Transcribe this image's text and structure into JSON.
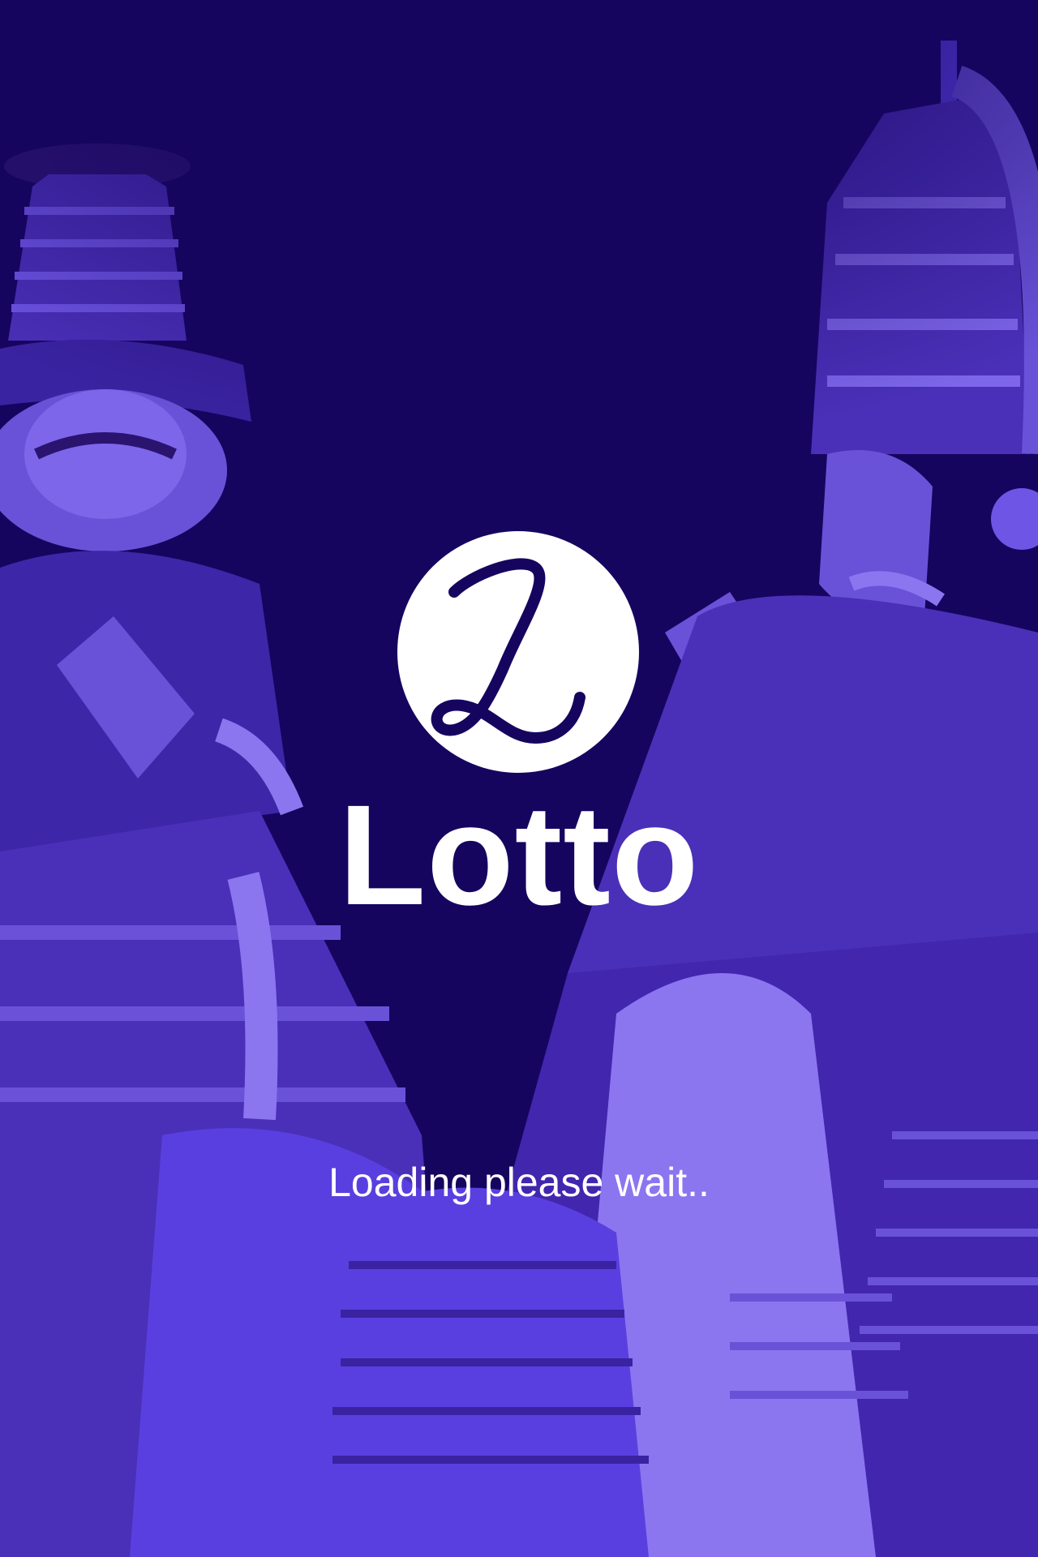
{
  "splash": {
    "logo_letter": "L",
    "app_name": "Lotto",
    "loading_text": "Loading please wait..",
    "background_image": "kathakali-performers-photo"
  },
  "colors": {
    "background": "#16055f",
    "tint": "#5a3fe0",
    "logo_circle": "#ffffff",
    "logo_letter": "#16055f",
    "text": "#ffffff"
  }
}
